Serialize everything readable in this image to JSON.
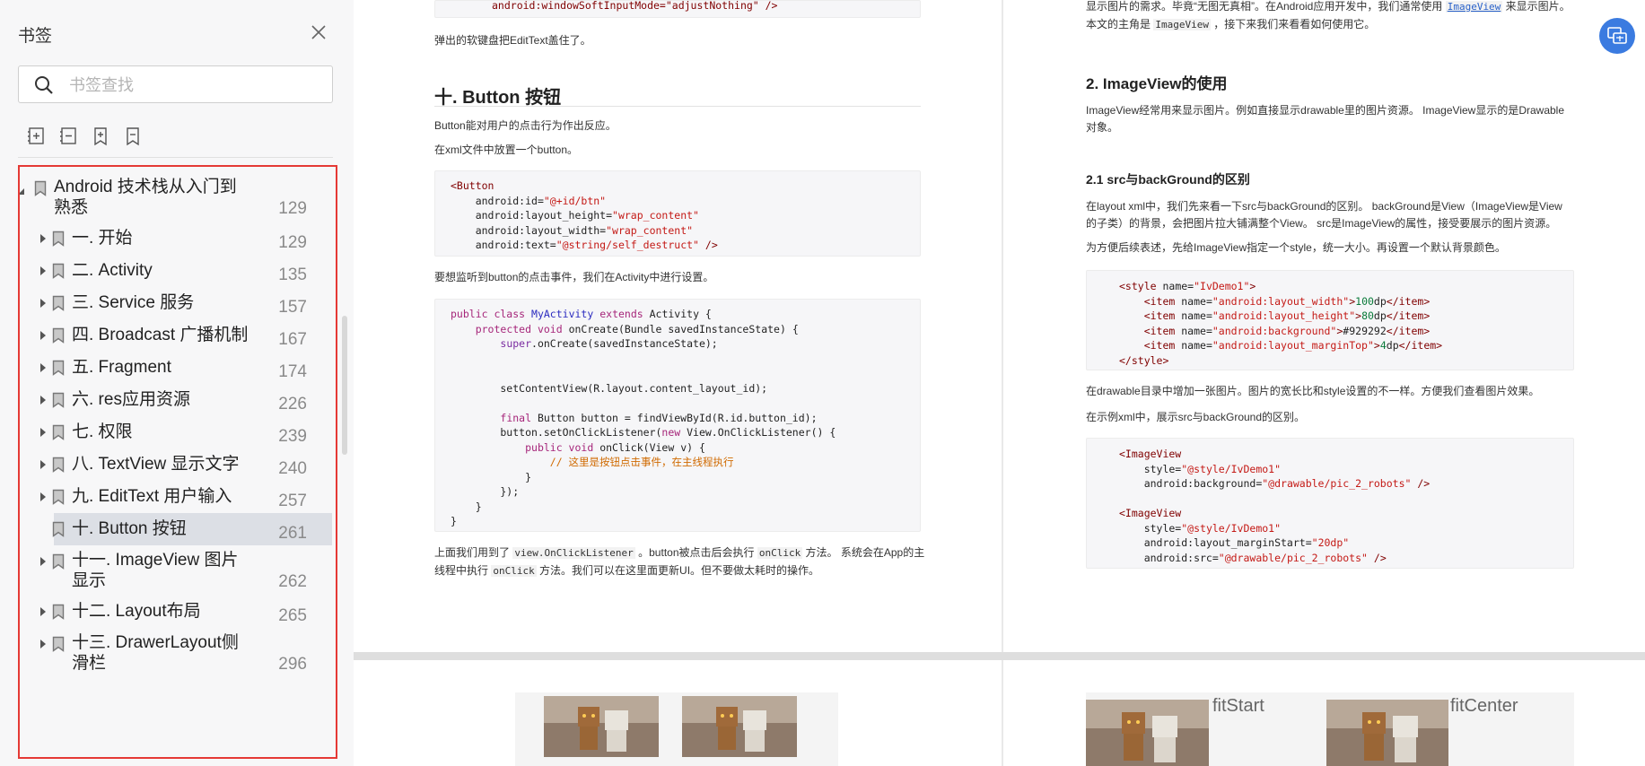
{
  "sidebar": {
    "title": "书签",
    "search_placeholder": "书签查找",
    "tools": [
      "add-bookmark-icon",
      "remove-bookmark-icon",
      "add-child-bookmark-icon",
      "bookmark-icon"
    ],
    "tree": [
      {
        "label_lines": [
          "Android 技术栈从入门到",
          "熟悉"
        ],
        "page": "129",
        "expanded": true,
        "level": 0
      },
      {
        "label_lines": [
          "一. 开始"
        ],
        "page": "129",
        "level": 1
      },
      {
        "label_lines": [
          "二. Activity"
        ],
        "page": "135",
        "level": 1
      },
      {
        "label_lines": [
          "三. Service 服务"
        ],
        "page": "157",
        "level": 1
      },
      {
        "label_lines": [
          "四. Broadcast 广播机制"
        ],
        "page": "167",
        "level": 1
      },
      {
        "label_lines": [
          "五. Fragment"
        ],
        "page": "174",
        "level": 1
      },
      {
        "label_lines": [
          "六. res应用资源"
        ],
        "page": "226",
        "level": 1
      },
      {
        "label_lines": [
          "七. 权限"
        ],
        "page": "239",
        "level": 1
      },
      {
        "label_lines": [
          "八. TextView 显示文字"
        ],
        "page": "240",
        "level": 1
      },
      {
        "label_lines": [
          "九. EditText 用户输入"
        ],
        "page": "257",
        "level": 1
      },
      {
        "label_lines": [
          "十. Button 按钮"
        ],
        "page": "261",
        "level": 1,
        "selected": true,
        "no_arrow": true
      },
      {
        "label_lines": [
          "十一. ImageView 图片",
          "显示"
        ],
        "page": "262",
        "level": 1
      },
      {
        "label_lines": [
          "十二. Layout布局"
        ],
        "page": "265",
        "level": 1
      },
      {
        "label_lines": [
          "十三. DrawerLayout侧",
          "滑栏"
        ],
        "page": "296",
        "level": 1
      }
    ]
  },
  "left_page": {
    "top_code": "android:windowSoftInputMode=\"adjustNothing\" />",
    "p1": "弹出的软键盘把EditText盖住了。",
    "heading": "十. Button 按钮",
    "p2": "Button能对用户的点击行为作出反应。",
    "p3": "在xml文件中放置一个button。",
    "p4": "要想监听到button的点击事件，我们在Activity中进行设置。",
    "p5a": "上面我们用到了 ",
    "p5code1": "view.OnClickListener",
    "p5b": " 。button被点击后会执行 ",
    "p5code2": "onClick",
    "p5c": " 方法。 系统会在App的主",
    "p6a": "线程中执行 ",
    "p6code": "onClick",
    "p6b": " 方法。我们可以在这里面更新UI。但不要做太耗时的操作。"
  },
  "right_page": {
    "p0a": "显示图片的需求。毕竟“无图无真相”。在Android应用开发中，我们通常使用 ",
    "p0link": "ImageView",
    "p0b": " 来显示图片。",
    "p0c": "本文的主角是 ",
    "p0code": "ImageView",
    "p0d": " ，接下来我们来看看如何使用它。",
    "h2": "2. ImageView的使用",
    "p1": "ImageView经常用来显示图片。例如直接显示drawable里的图片资源。 ImageView显示的是Drawable",
    "p1b": "对象。",
    "h3": "2.1 src与backGround的区别",
    "p2": "在layout xml中，我们先来看一下src与backGround的区别。 backGround是View（ImageView是View",
    "p2b": "的子类）的背景，会把图片拉大铺满整个View。 src是ImageView的属性，接受要展示的图片资源。",
    "p3": "为方便后续表述，先给ImageView指定一个style，统一大小。再设置一个默认背景颜色。",
    "p4": "在drawable目录中增加一张图片。图片的宽长比和style设置的不一样。方便我们查看图片效果。",
    "p5": "在示例xml中，展示src与backGround的区别。"
  },
  "bottom": {
    "label_fitstart": "fitStart",
    "label_fitcenter": "fitCenter"
  },
  "colors": {
    "accent": "#3b7be0",
    "highlight_border": "#e53935",
    "selected_row": "#dcdfe5"
  }
}
